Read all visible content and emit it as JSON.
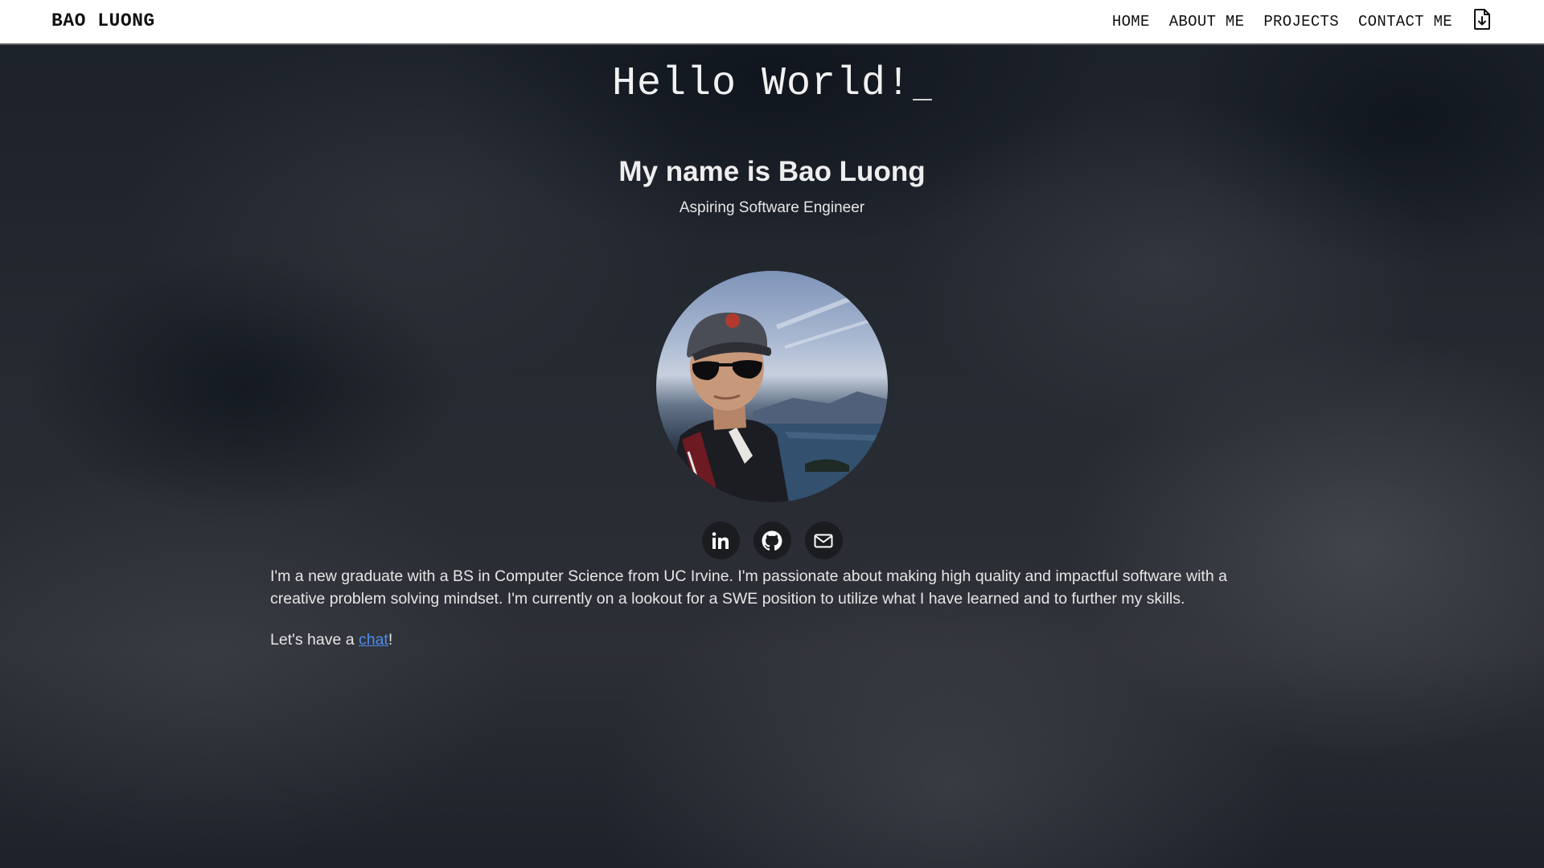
{
  "nav": {
    "brand": "BAO LUONG",
    "links": [
      {
        "label": "HOME"
      },
      {
        "label": "ABOUT ME"
      },
      {
        "label": "PROJECTS"
      },
      {
        "label": "CONTACT ME"
      }
    ],
    "resume_icon": "file-download-icon"
  },
  "hero": {
    "greeting": "Hello World!",
    "name": "My name is Bao Luong",
    "tagline": "Aspiring Software Engineer"
  },
  "social": [
    {
      "icon": "linkedin-icon"
    },
    {
      "icon": "github-icon"
    },
    {
      "icon": "mail-icon"
    }
  ],
  "about": {
    "bio": "I'm a new graduate with a BS in Computer Science from UC Irvine. I'm passionate about making high quality and impactful software with a creative problem solving mindset. I'm currently on a lookout for a SWE position to utilize what I have learned and to further my skills.",
    "chat_prefix": "Let's have a ",
    "chat_link": "chat",
    "chat_suffix": "!"
  },
  "colors": {
    "nav_bg": "#ffffff",
    "link_accent": "#4d8df0",
    "icon_button_bg": "#1a1c20"
  }
}
